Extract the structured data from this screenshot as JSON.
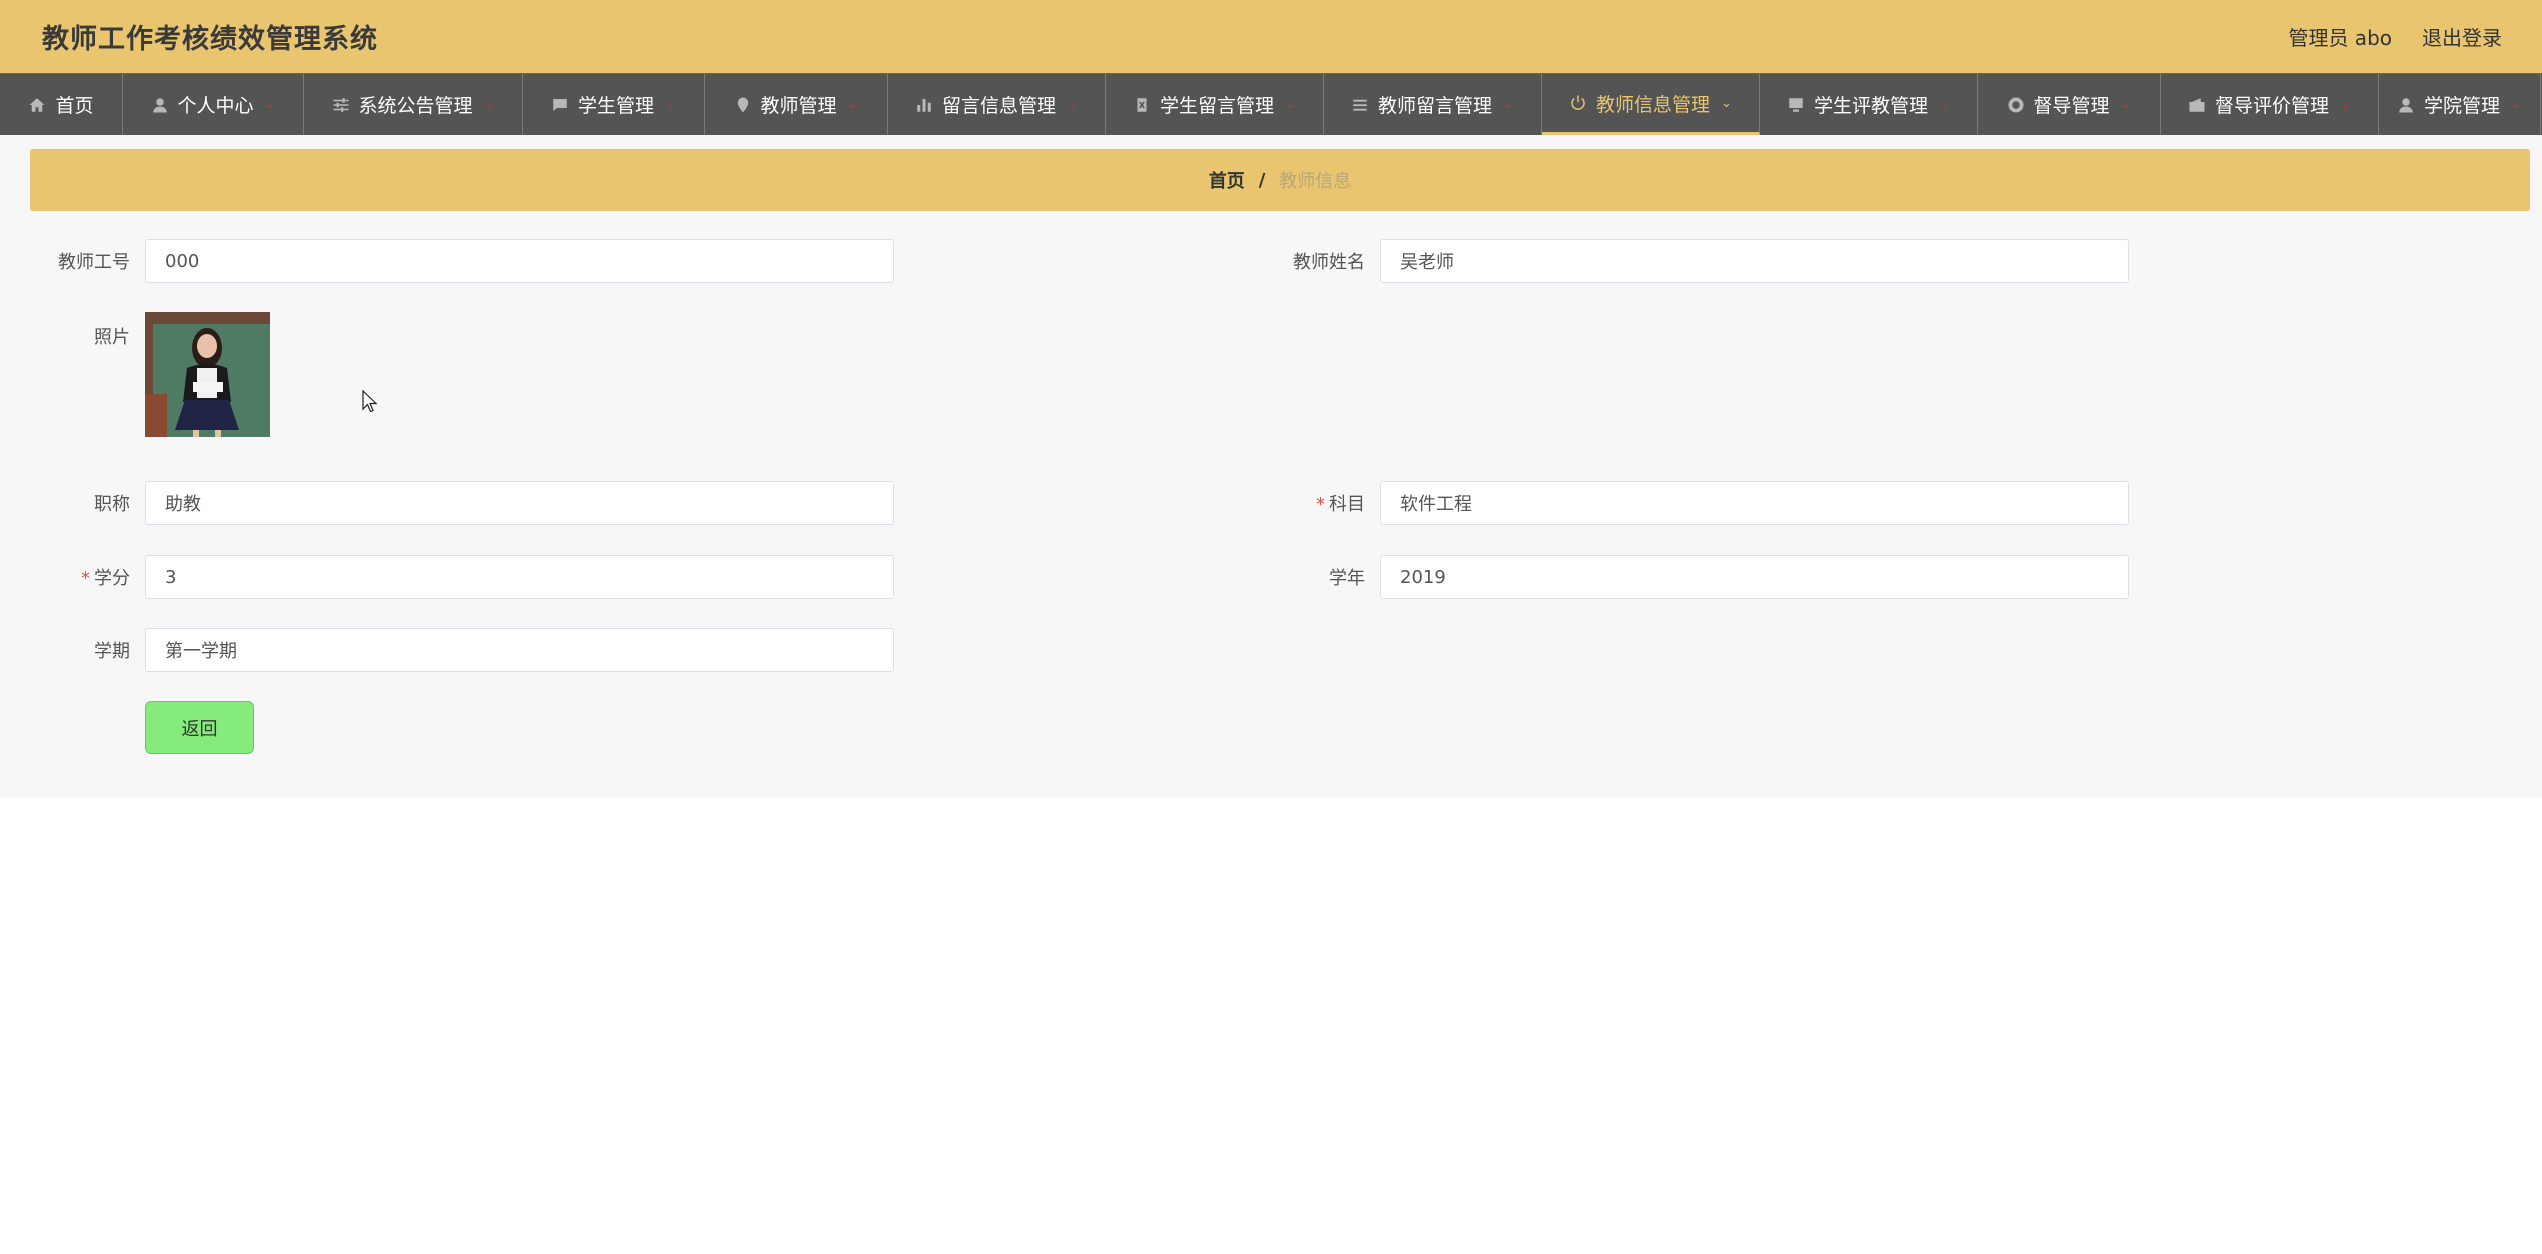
{
  "header": {
    "title": "教师工作考核绩效管理系统",
    "user_label": "管理员 abo",
    "logout_label": "退出登录"
  },
  "nav": {
    "items": [
      {
        "label": "首页",
        "icon": "home-icon"
      },
      {
        "label": "个人中心",
        "icon": "user-icon"
      },
      {
        "label": "系统公告管理",
        "icon": "sliders-icon"
      },
      {
        "label": "学生管理",
        "icon": "chat-icon"
      },
      {
        "label": "教师管理",
        "icon": "location-pin-icon"
      },
      {
        "label": "留言信息管理",
        "icon": "bar-chart-icon"
      },
      {
        "label": "学生留言管理",
        "icon": "clipboard-icon"
      },
      {
        "label": "教师留言管理",
        "icon": "list-icon"
      },
      {
        "label": "教师信息管理",
        "icon": "power-icon"
      },
      {
        "label": "学生评教管理",
        "icon": "monitor-icon"
      },
      {
        "label": "督导管理",
        "icon": "lifebuoy-icon"
      },
      {
        "label": "督导评价管理",
        "icon": "wallet-icon"
      },
      {
        "label": "学院管理",
        "icon": "user-icon"
      }
    ],
    "active_index": 8
  },
  "breadcrumb": {
    "home": "首页",
    "separator": "/",
    "current": "教师信息"
  },
  "form": {
    "teacher_id": {
      "label": "教师工号",
      "value": "000"
    },
    "teacher_name": {
      "label": "教师姓名",
      "value": "吴老师"
    },
    "photo": {
      "label": "照片"
    },
    "title": {
      "label": "职称",
      "value": "助教"
    },
    "subject": {
      "label": "科目",
      "value": "软件工程",
      "required": "*"
    },
    "credit": {
      "label": "学分",
      "value": "3",
      "required": "*"
    },
    "year": {
      "label": "学年",
      "value": "2019"
    },
    "semester": {
      "label": "学期",
      "value": "第一学期"
    },
    "back_button": "返回"
  },
  "colors": {
    "accent": "#e8c56e",
    "nav_bg": "#545454",
    "button_green": "#85ec7b",
    "required_red": "#e74c3c"
  }
}
